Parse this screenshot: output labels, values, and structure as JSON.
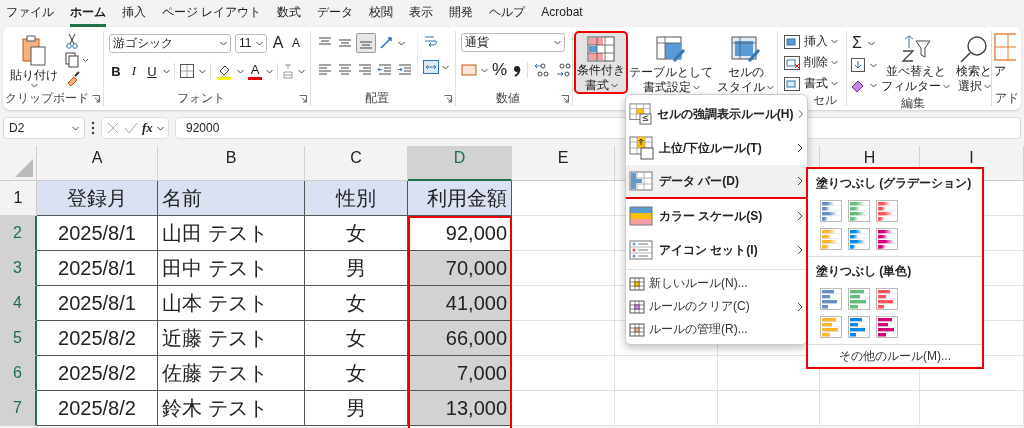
{
  "tabs": [
    {
      "label": "ファイル",
      "selected": false
    },
    {
      "label": "ホーム",
      "selected": true
    },
    {
      "label": "挿入",
      "selected": false
    },
    {
      "label": "ページ レイアウト",
      "selected": false
    },
    {
      "label": "数式",
      "selected": false
    },
    {
      "label": "データ",
      "selected": false
    },
    {
      "label": "校閲",
      "selected": false
    },
    {
      "label": "表示",
      "selected": false
    },
    {
      "label": "開発",
      "selected": false
    },
    {
      "label": "ヘルプ",
      "selected": false
    },
    {
      "label": "Acrobat",
      "selected": false
    }
  ],
  "ribbon": {
    "clipboard": {
      "paste": "貼り付け",
      "label": "クリップボード"
    },
    "font": {
      "font_name": "游ゴシック",
      "font_size": "11",
      "grow": "A",
      "shrink": "A",
      "bold": "B",
      "italic": "I",
      "underline": "U",
      "font_color": "A",
      "label": "フォント"
    },
    "alignment": {
      "label": "配置"
    },
    "number": {
      "format": "通貨",
      "percent": "%",
      "label": "数値"
    },
    "styles": {
      "buttons": [
        {
          "lines": [
            "条件付き",
            "書式"
          ],
          "selected": true
        },
        {
          "lines": [
            "テーブルとして",
            "書式設定"
          ],
          "selected": false
        },
        {
          "lines": [
            "セルの",
            "スタイル"
          ],
          "selected": false
        }
      ]
    },
    "cells": {
      "buttons": [
        "挿入",
        "削除",
        "書式"
      ],
      "label": "セル"
    },
    "editing": {
      "sum": "Σ",
      "buttons": [
        {
          "lines": [
            "並べ替えと",
            "フィルター"
          ]
        },
        {
          "lines": [
            "検索と",
            "選択"
          ]
        }
      ],
      "label": "編集"
    },
    "addins": {
      "top": "ア",
      "label": "アド"
    }
  },
  "formula_bar": {
    "name_box": "D2",
    "fx": "fx",
    "formula": "92000"
  },
  "grid": {
    "columns": [
      {
        "label": "A",
        "selected": false
      },
      {
        "label": "B",
        "selected": false
      },
      {
        "label": "C",
        "selected": false
      },
      {
        "label": "D",
        "selected": true
      },
      {
        "label": "E",
        "selected": false
      },
      {
        "selected": false
      },
      {
        "selected": false
      },
      {
        "label": "H",
        "selected": false
      },
      {
        "label": "I",
        "selected": false
      }
    ],
    "rows": [
      {
        "number": "1",
        "selected": false,
        "active": false,
        "kind": "header",
        "cells": [
          "登録月",
          "名前",
          "性別",
          "利用金額"
        ]
      },
      {
        "number": "2",
        "selected": true,
        "active": true,
        "kind": "data",
        "cells": [
          "2025/8/1",
          "山田 テスト",
          "女",
          "92,000"
        ]
      },
      {
        "number": "3",
        "selected": true,
        "active": false,
        "kind": "data",
        "cells": [
          "2025/8/1",
          "田中 テスト",
          "男",
          "70,000"
        ]
      },
      {
        "number": "4",
        "selected": true,
        "active": false,
        "kind": "data",
        "cells": [
          "2025/8/1",
          "山本 テスト",
          "女",
          "41,000"
        ]
      },
      {
        "number": "5",
        "selected": true,
        "active": false,
        "kind": "data",
        "cells": [
          "2025/8/2",
          "近藤 テスト",
          "女",
          "66,000"
        ]
      },
      {
        "number": "6",
        "selected": true,
        "active": false,
        "kind": "data",
        "cells": [
          "2025/8/2",
          "佐藤 テスト",
          "女",
          "7,000"
        ]
      },
      {
        "number": "7",
        "selected": true,
        "active": false,
        "kind": "data",
        "cells": [
          "2025/8/2",
          "鈴木 テスト",
          "男",
          "13,000"
        ]
      }
    ]
  },
  "menu": {
    "items": [
      {
        "kind": "large",
        "label": "セルの強調表示ルール(H)",
        "submenu": true,
        "selected": false
      },
      {
        "kind": "large",
        "label": "上位/下位ルール(T)",
        "submenu": true,
        "selected": false
      },
      {
        "kind": "large",
        "label": "データ バー(D)",
        "submenu": true,
        "selected": true
      },
      {
        "kind": "large",
        "label": "カラー スケール(S)",
        "submenu": true,
        "selected": false
      },
      {
        "kind": "large",
        "label": "アイコン セット(I)",
        "submenu": true,
        "selected": false
      },
      {
        "kind": "small",
        "label": "新しいルール(N)...",
        "submenu": false,
        "selected": false
      },
      {
        "kind": "small",
        "label": "ルールのクリア(C)",
        "submenu": true,
        "selected": false
      },
      {
        "kind": "small",
        "label": "ルールの管理(R)...",
        "submenu": false,
        "selected": false
      }
    ]
  },
  "submenu": {
    "sections": [
      {
        "title": "塗りつぶし (グラデーション)",
        "kind": "gradient",
        "swatches": [
          {
            "color": "#638ec6"
          },
          {
            "color": "#63be7b"
          },
          {
            "color": "#ff555a"
          },
          {
            "color": "#ffb628"
          },
          {
            "color": "#008aef"
          },
          {
            "color": "#d6007b"
          }
        ]
      },
      {
        "title": "塗りつぶし (単色)",
        "kind": "solid",
        "swatches": [
          {
            "color": "#638ec6"
          },
          {
            "color": "#63be7b"
          },
          {
            "color": "#ff555a"
          },
          {
            "color": "#ffb628"
          },
          {
            "color": "#008aef"
          },
          {
            "color": "#d6007b"
          }
        ]
      }
    ],
    "footer": "その他のルール(M)..."
  }
}
